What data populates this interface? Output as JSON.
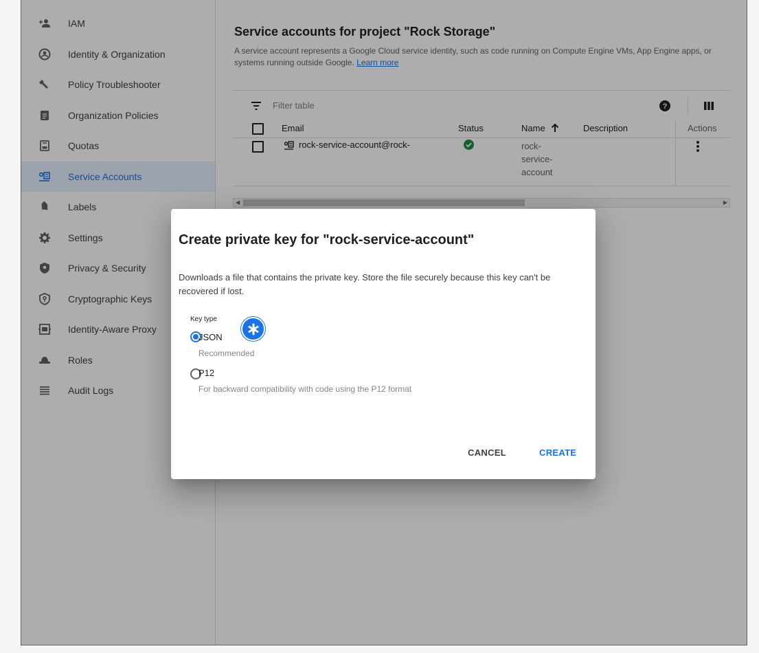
{
  "sidebar": {
    "items": [
      {
        "label": "IAM",
        "icon": "add-person-icon"
      },
      {
        "label": "Identity & Organization",
        "icon": "account-circle-icon"
      },
      {
        "label": "Policy Troubleshooter",
        "icon": "wrench-icon"
      },
      {
        "label": "Organization Policies",
        "icon": "document-icon"
      },
      {
        "label": "Quotas",
        "icon": "quota-icon"
      },
      {
        "label": "Service Accounts",
        "icon": "service-account-icon",
        "active": true
      },
      {
        "label": "Labels",
        "icon": "label-icon"
      },
      {
        "label": "Settings",
        "icon": "gear-icon"
      },
      {
        "label": "Privacy & Security",
        "icon": "shield-icon"
      },
      {
        "label": "Cryptographic Keys",
        "icon": "key-shield-icon"
      },
      {
        "label": "Identity-Aware Proxy",
        "icon": "proxy-icon"
      },
      {
        "label": "Roles",
        "icon": "hat-icon"
      },
      {
        "label": "Audit Logs",
        "icon": "list-icon"
      }
    ]
  },
  "main": {
    "title": "Service accounts for project \"Rock Storage\"",
    "description": "A service account represents a Google Cloud service identity, such as code running on Compute Engine VMs, App Engine apps, or systems running outside Google.",
    "learn_more": "Learn more",
    "filter_placeholder": "Filter table",
    "columns": {
      "email": "Email",
      "status": "Status",
      "name": "Name",
      "description": "Description",
      "actions": "Actions"
    },
    "rows": [
      {
        "email": "rock-service-account@rock-",
        "status": "enabled",
        "name_line1": "rock-",
        "name_line2": "service-",
        "name_line3": "account"
      }
    ]
  },
  "dialog": {
    "title": "Create private key for \"rock-service-account\"",
    "description": "Downloads a file that contains the private key. Store the file securely because this key can't be recovered if lost.",
    "key_type_label": "Key type",
    "options": [
      {
        "label": "JSON",
        "hint": "Recommended",
        "selected": true
      },
      {
        "label": "P12",
        "hint": "For backward compatibility with code using the P12 format",
        "selected": false
      }
    ],
    "cancel_label": "CANCEL",
    "create_label": "CREATE"
  },
  "colors": {
    "accent": "#1a73e8",
    "status_ok": "#1e8e3e"
  }
}
